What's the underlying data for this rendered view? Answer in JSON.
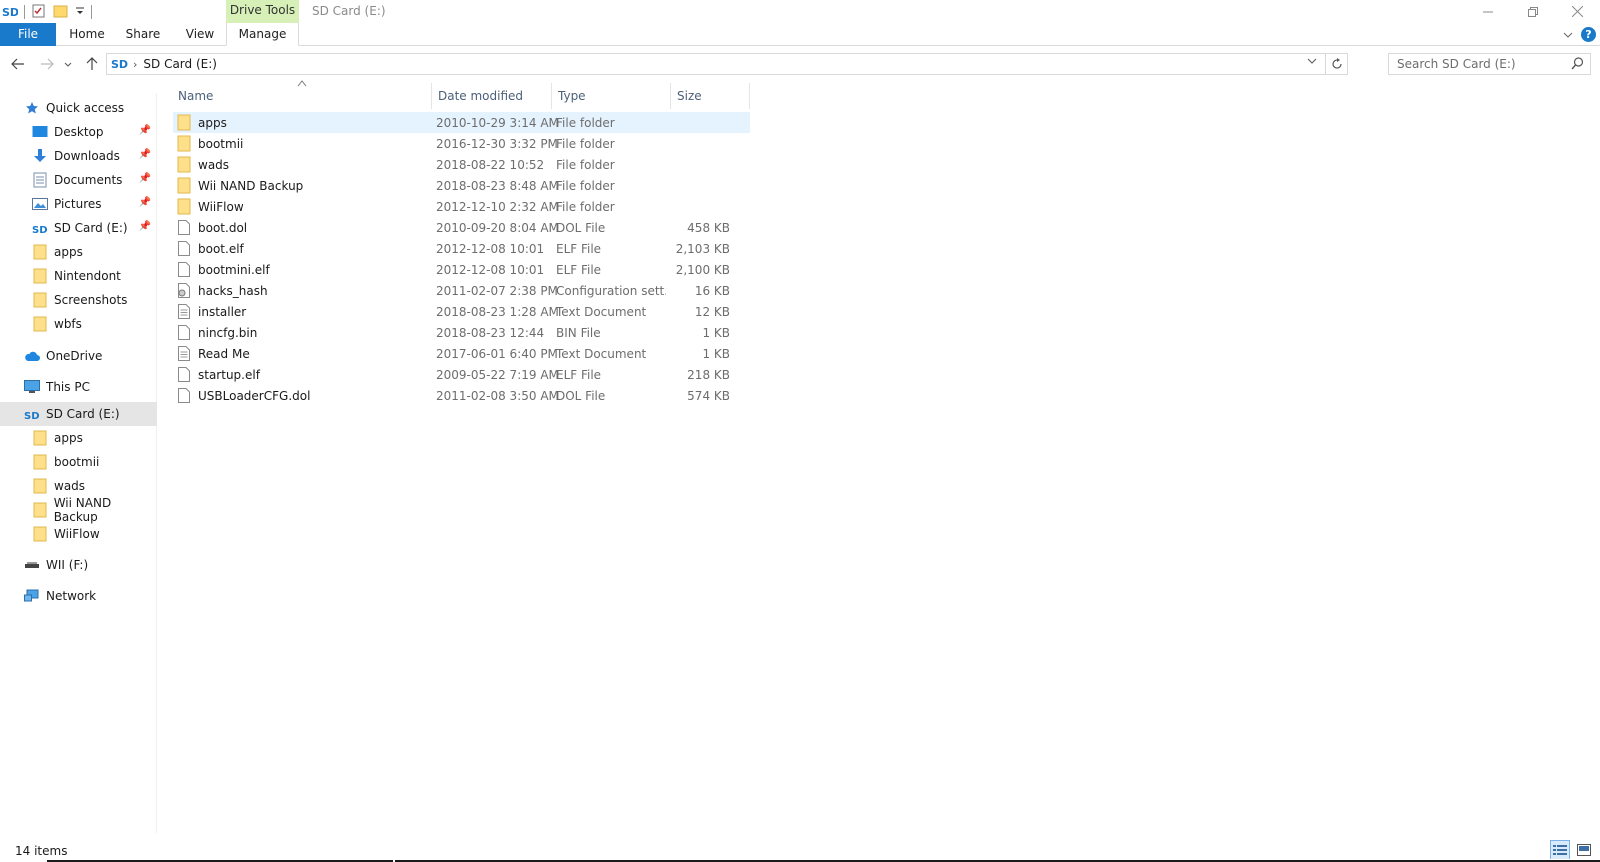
{
  "window": {
    "title": "SD Card (E:)",
    "context_tab": "Drive Tools",
    "accent_color": "#1979ca",
    "context_color": "#d6f0b8"
  },
  "ribbon": {
    "tabs": [
      {
        "label": "File"
      },
      {
        "label": "Home"
      },
      {
        "label": "Share"
      },
      {
        "label": "View"
      },
      {
        "label": "Manage"
      }
    ],
    "help": "?"
  },
  "address": {
    "crumb": "SD Card (E:)",
    "search_placeholder": "Search SD Card (E:)"
  },
  "sidebar": {
    "items": [
      {
        "label": "Quick access",
        "icon": "star-icon"
      },
      {
        "label": "Desktop",
        "icon": "desktop-icon",
        "pinned": true
      },
      {
        "label": "Downloads",
        "icon": "download-icon",
        "pinned": true
      },
      {
        "label": "Documents",
        "icon": "documents-icon",
        "pinned": true
      },
      {
        "label": "Pictures",
        "icon": "pictures-icon",
        "pinned": true
      },
      {
        "label": "SD Card (E:)",
        "icon": "sd-card-icon",
        "pinned": true
      },
      {
        "label": "apps",
        "icon": "folder-icon"
      },
      {
        "label": "Nintendont",
        "icon": "folder-icon"
      },
      {
        "label": "Screenshots",
        "icon": "folder-icon"
      },
      {
        "label": "wbfs",
        "icon": "folder-icon"
      },
      {
        "label": "OneDrive",
        "icon": "cloud-icon"
      },
      {
        "label": "This PC",
        "icon": "computer-icon"
      },
      {
        "label": "SD Card (E:)",
        "icon": "sd-card-icon",
        "selected": true
      },
      {
        "label": "apps",
        "icon": "folder-icon"
      },
      {
        "label": "bootmii",
        "icon": "folder-icon"
      },
      {
        "label": "wads",
        "icon": "folder-icon"
      },
      {
        "label": "Wii NAND Backup",
        "icon": "folder-icon"
      },
      {
        "label": "WiiFlow",
        "icon": "folder-icon"
      },
      {
        "label": "WII (F:)",
        "icon": "usb-drive-icon"
      },
      {
        "label": "Network",
        "icon": "network-icon"
      }
    ]
  },
  "columns": {
    "name": "Name",
    "date": "Date modified",
    "type": "Type",
    "size": "Size"
  },
  "files": [
    {
      "name": "apps",
      "date": "2010-10-29 3:14 AM",
      "type": "File folder",
      "size": "",
      "icon": "folder-icon"
    },
    {
      "name": "bootmii",
      "date": "2016-12-30 3:32 PM",
      "type": "File folder",
      "size": "",
      "icon": "folder-icon"
    },
    {
      "name": "wads",
      "date": "2018-08-22 10:52",
      "type": "File folder",
      "size": "",
      "icon": "folder-icon"
    },
    {
      "name": "Wii NAND Backup",
      "date": "2018-08-23 8:48 AM",
      "type": "File folder",
      "size": "",
      "icon": "folder-icon"
    },
    {
      "name": "WiiFlow",
      "date": "2012-12-10 2:32 AM",
      "type": "File folder",
      "size": "",
      "icon": "folder-icon"
    },
    {
      "name": "boot.dol",
      "date": "2010-09-20 8:04 AM",
      "type": "DOL File",
      "size": "458 KB",
      "icon": "file-icon"
    },
    {
      "name": "boot.elf",
      "date": "2012-12-08 10:01",
      "type": "ELF File",
      "size": "2,103 KB",
      "icon": "file-icon"
    },
    {
      "name": "bootmini.elf",
      "date": "2012-12-08 10:01",
      "type": "ELF File",
      "size": "2,100 KB",
      "icon": "file-icon"
    },
    {
      "name": "hacks_hash",
      "date": "2011-02-07 2:38 PM",
      "type": "Configuration sett...",
      "size": "16 KB",
      "icon": "config-file-icon"
    },
    {
      "name": "installer",
      "date": "2018-08-23 1:28 AM",
      "type": "Text Document",
      "size": "12 KB",
      "icon": "text-file-icon"
    },
    {
      "name": "nincfg.bin",
      "date": "2018-08-23 12:44",
      "type": "BIN File",
      "size": "1 KB",
      "icon": "file-icon"
    },
    {
      "name": "Read Me",
      "date": "2017-06-01 6:40 PM",
      "type": "Text Document",
      "size": "1 KB",
      "icon": "text-file-icon"
    },
    {
      "name": "startup.elf",
      "date": "2009-05-22 7:19 AM",
      "type": "ELF File",
      "size": "218 KB",
      "icon": "file-icon"
    },
    {
      "name": "USBLoaderCFG.dol",
      "date": "2011-02-08 3:50 AM",
      "type": "DOL File",
      "size": "574 KB",
      "icon": "file-icon"
    }
  ],
  "status": {
    "count": "14 items"
  }
}
